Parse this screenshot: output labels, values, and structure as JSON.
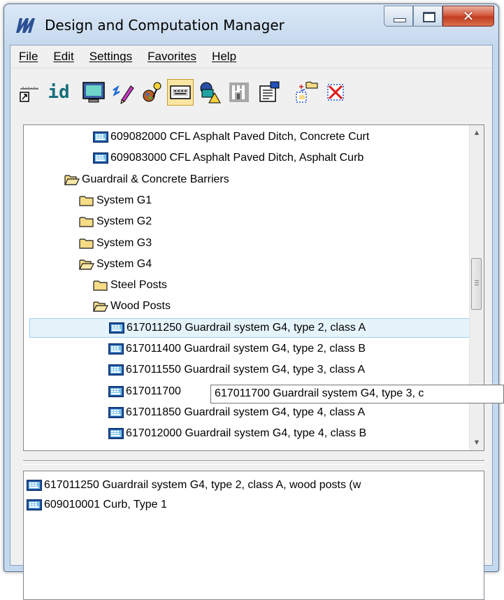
{
  "window": {
    "title": "Design and Computation Manager"
  },
  "menu": [
    "File",
    "Edit",
    "Settings",
    "Favorites",
    "Help"
  ],
  "toolbar": {
    "id_label": "id",
    "buttons": [
      "place-cell-icon",
      "id-icon",
      "monitor-icon",
      "draw-tool-icon",
      "palette-icon",
      "keyboard-icon",
      "shapes-icon",
      "compute-icon",
      "properties-icon",
      "add-item-icon",
      "delete-icon"
    ],
    "active_button": "keyboard-icon"
  },
  "tree": {
    "items": [
      {
        "label": "609082000 CFL Asphalt Paved Ditch, Concrete Curt",
        "type": "item",
        "level": 3
      },
      {
        "label": "609083000 CFL Asphalt Paved Ditch, Asphalt Curb",
        "type": "item",
        "level": 3
      },
      {
        "label": "Guardrail & Concrete Barriers",
        "type": "folder-open",
        "level": 1
      },
      {
        "label": "System G1",
        "type": "folder",
        "level": 2
      },
      {
        "label": "System G2",
        "type": "folder",
        "level": 2
      },
      {
        "label": "System G3",
        "type": "folder",
        "level": 2
      },
      {
        "label": "System G4",
        "type": "folder-open",
        "level": 2
      },
      {
        "label": "Steel Posts",
        "type": "folder",
        "level": 3
      },
      {
        "label": "Wood Posts",
        "type": "folder-open",
        "level": 3
      },
      {
        "label": "617011250 Guardrail system G4,  type 2, class A",
        "type": "item",
        "level": 4,
        "selected": true
      },
      {
        "label": "617011400 Guardrail system G4,  type 2, class B",
        "type": "item",
        "level": 4
      },
      {
        "label": "617011550 Guardrail system G4,  type 3, class A",
        "type": "item",
        "level": 4
      },
      {
        "label": "617011700",
        "type": "item",
        "level": 4
      },
      {
        "label": "617011850 Guardrail system G4,  type 4, class A",
        "type": "item",
        "level": 4
      },
      {
        "label": "617012000 Guardrail system G4,  type 4, class B",
        "type": "item",
        "level": 4
      }
    ],
    "tooltip": "617011700 Guardrail system G4,  type 3, c"
  },
  "list": {
    "items": [
      "617011250 Guardrail system G4,  type 2, class A, wood posts (w",
      "609010001 Curb, Type 1"
    ]
  },
  "colors": {
    "title_bg": "#c4d9ee",
    "selection_bg": "#e5f3fb",
    "selection_border": "#9fd2ef",
    "folder": "#f3d37a",
    "close_button": "#c94a2e"
  }
}
